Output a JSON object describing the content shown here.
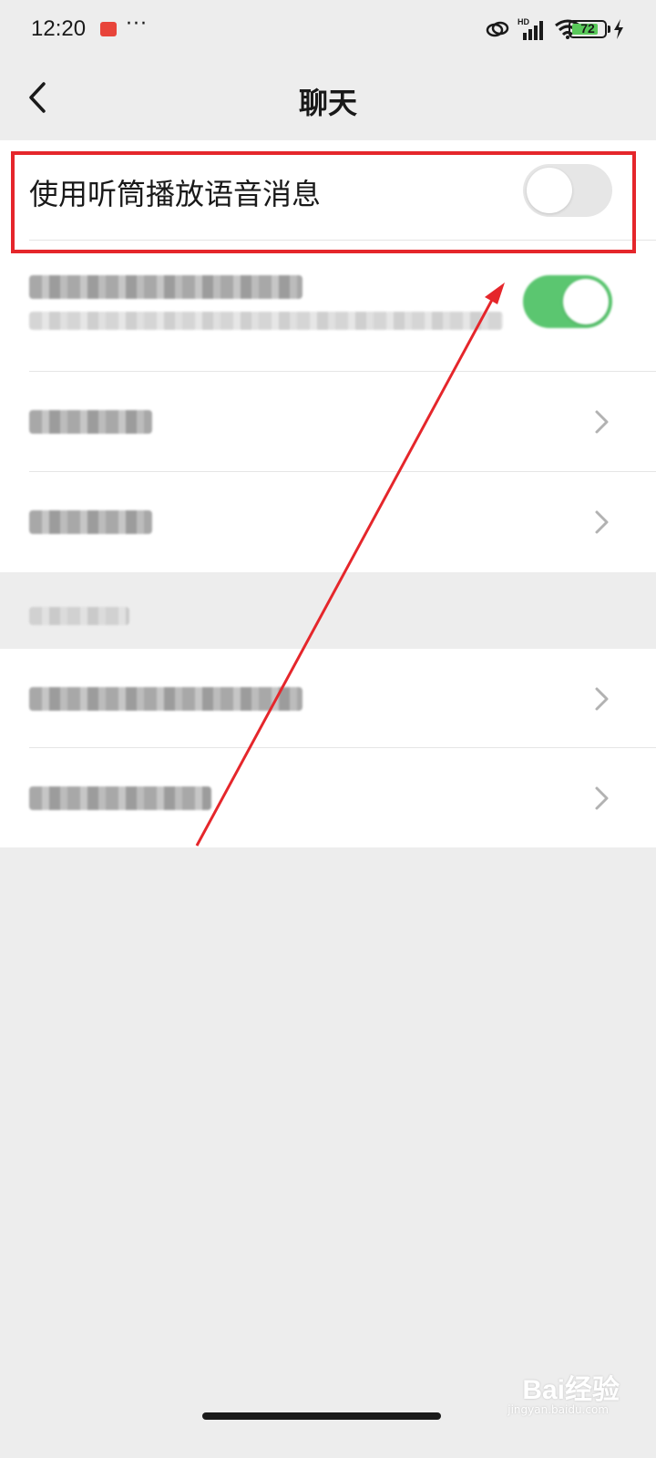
{
  "status_bar": {
    "time": "12:20",
    "more": "···",
    "network": "HD",
    "battery_level": "72"
  },
  "nav": {
    "back_icon": "chevron-left-icon",
    "title": "聊天"
  },
  "settings": {
    "earpiece_label": "使用听筒播放语音消息",
    "earpiece_enabled": false,
    "blurred_toggle_enabled": true
  },
  "colors": {
    "highlight": "#e5262b",
    "toggle_on": "#5bc670",
    "toggle_off": "#e6e6e6",
    "background": "#ededed"
  },
  "watermark": {
    "brand": "Bai经验",
    "url": "jingyan.baidu.com"
  }
}
